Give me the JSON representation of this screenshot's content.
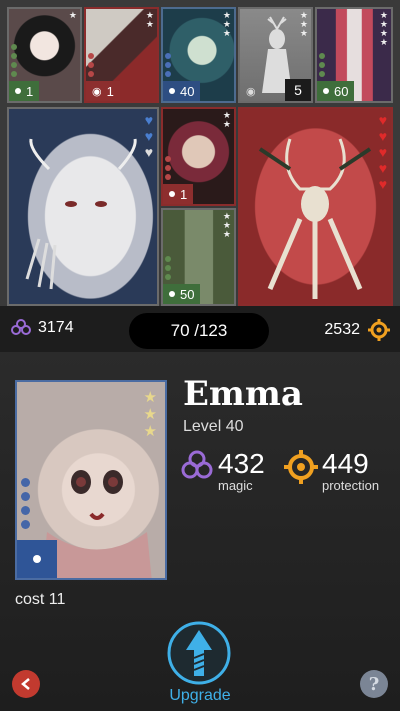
{
  "grid": {
    "cards": [
      {
        "name": "black-doll",
        "stars": 1,
        "badge": "1",
        "badge_icon": "dot-icon"
      },
      {
        "name": "plague-bird",
        "stars": 2,
        "badge": "1",
        "badge_icon": "swirl-icon"
      },
      {
        "name": "frog-girl",
        "stars": 3,
        "badge": "40",
        "badge_icon": "dot-icon"
      },
      {
        "name": "stag-silhouette",
        "stars": 3,
        "badge": "",
        "badge_icon": "swirl-icon",
        "count": "5"
      },
      {
        "name": "masked-knight",
        "stars": 4,
        "badge": "60",
        "badge_icon": "dot-icon"
      },
      {
        "name": "white-beast",
        "hearts": 3
      },
      {
        "name": "harlequin",
        "stars": 2,
        "badge": "1",
        "badge_icon": "dot-icon"
      },
      {
        "name": "clown-trio",
        "stars": 3,
        "badge": "50",
        "badge_icon": "dot-icon"
      },
      {
        "name": "horned-mantis",
        "hearts": 5
      }
    ]
  },
  "statsbar": {
    "magic_total": "3174",
    "collection": "70 /123",
    "protection_total": "2532"
  },
  "detail": {
    "name": "Emma",
    "level": "Level 40",
    "magic": "432",
    "magic_label": "magic",
    "protection": "449",
    "protection_label": "protection",
    "cost": "cost 11",
    "upgrade_label": "Upgrade",
    "help_symbol": "?"
  },
  "colors": {
    "accent_blue": "#3fb0e8",
    "magic_purple": "#9a6bd6",
    "protection_orange": "#f0a020",
    "back_red": "#c23a2f"
  }
}
